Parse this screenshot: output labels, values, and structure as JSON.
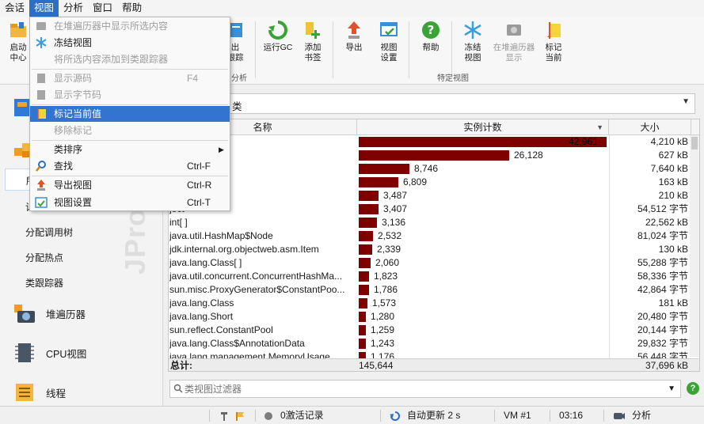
{
  "menubar": [
    "会话",
    "视图",
    "分析",
    "窗口",
    "帮助"
  ],
  "toolbar": {
    "start_center": "启动\n中心",
    "run_gc": "运行GC",
    "add_bookmark": "添加\n书签",
    "export": "导出",
    "view_settings": "视图\n设置",
    "help": "帮助",
    "freeze": "冻结\n视图",
    "show_in_heap": "在堆遍历器\n显示",
    "mark_current": "标记\n当前",
    "partial_cut": "出\n跟踪",
    "group_analysis": "分析",
    "group_specific": "特定视图"
  },
  "leftnav": {
    "sub_items": [
      "分配调用树",
      "分配热点",
      "类跟踪器"
    ],
    "big_items": [
      "堆遍历器",
      "CPU视图",
      "线程"
    ],
    "partial_a": "所",
    "partial_b": "记",
    "watermark": "JProfiler"
  },
  "aggregation": {
    "label": "类"
  },
  "table": {
    "headers": [
      "名称",
      "实例计数",
      "大小"
    ],
    "rows": [
      {
        "name": "",
        "count": "42,961",
        "size": "4,210 kB",
        "frac": 1.0
      },
      {
        "name": "ng",
        "count": "26,128",
        "size": "627 kB",
        "frac": 0.6082
      },
      {
        "name": "",
        "count": "8,746",
        "size": "7,640 kB",
        "frac": 0.2036
      },
      {
        "name": "ngBuilder",
        "count": "6,809",
        "size": "163 kB",
        "frac": 0.1585
      },
      {
        "name": "ect[ ]",
        "count": "3,487",
        "size": "210 kB",
        "frac": 0.0812
      },
      {
        "name": "ject",
        "count": "3,407",
        "size": "54,512 字节",
        "frac": 0.0793
      },
      {
        "name": "int[ ]",
        "count": "3,136",
        "size": "22,562 kB",
        "frac": 0.073
      },
      {
        "name": "java.util.HashMap$Node",
        "count": "2,532",
        "size": "81,024 字节",
        "frac": 0.0589
      },
      {
        "name": "jdk.internal.org.objectweb.asm.Item",
        "count": "2,339",
        "size": "130 kB",
        "frac": 0.0544
      },
      {
        "name": "java.lang.Class[ ]",
        "count": "2,060",
        "size": "55,288 字节",
        "frac": 0.048
      },
      {
        "name": "java.util.concurrent.ConcurrentHashMa...",
        "count": "1,823",
        "size": "58,336 字节",
        "frac": 0.0424
      },
      {
        "name": "sun.misc.ProxyGenerator$ConstantPoo...",
        "count": "1,786",
        "size": "42,864 字节",
        "frac": 0.0416
      },
      {
        "name": "java.lang.Class",
        "count": "1,573",
        "size": "181 kB",
        "frac": 0.0366
      },
      {
        "name": "java.lang.Short",
        "count": "1,280",
        "size": "20,480 字节",
        "frac": 0.0298
      },
      {
        "name": "sun.reflect.ConstantPool",
        "count": "1,259",
        "size": "20,144 字节",
        "frac": 0.0293
      },
      {
        "name": "java.lang.Class$AnnotationData",
        "count": "1,243",
        "size": "29,832 字节",
        "frac": 0.0289
      },
      {
        "name": "java.lang.management.MemoryUsage",
        "count": "1,176",
        "size": "56,448 字节",
        "frac": 0.0274
      }
    ],
    "total_label": "总计:",
    "total_count": "145,644",
    "total_size": "37,696 kB"
  },
  "filter": {
    "placeholder": "类视图过滤器"
  },
  "statusbar": {
    "records": "0激活记录",
    "auto_update": "自动更新 2 s",
    "vm": "VM #1",
    "time": "03:16",
    "analysis": "分析"
  },
  "dropdown": {
    "items": [
      {
        "label": "在堆遍历器中显示所选内容",
        "shortcut": "",
        "disabled": true
      },
      {
        "label": "冻结视图",
        "shortcut": "",
        "disabled": false
      },
      {
        "label": "将所选内容添加到类跟踪器",
        "shortcut": "",
        "disabled": true
      },
      {
        "label": "显示源码",
        "shortcut": "F4",
        "disabled": true
      },
      {
        "label": "显示字节码",
        "shortcut": "",
        "disabled": true
      },
      {
        "label": "标记当前值",
        "shortcut": "",
        "disabled": false
      },
      {
        "label": "移除标记",
        "shortcut": "",
        "disabled": true
      },
      {
        "label": "类排序",
        "shortcut": "",
        "disabled": false
      },
      {
        "label": "查找",
        "shortcut": "Ctrl-F",
        "disabled": false
      },
      {
        "label": "导出视图",
        "shortcut": "Ctrl-R",
        "disabled": false
      },
      {
        "label": "视图设置",
        "shortcut": "Ctrl-T",
        "disabled": false
      }
    ]
  },
  "colors": {
    "bar": "#7e0000",
    "menu_highlight": "#3474d1",
    "menubar_active": "#2a6fc9"
  }
}
